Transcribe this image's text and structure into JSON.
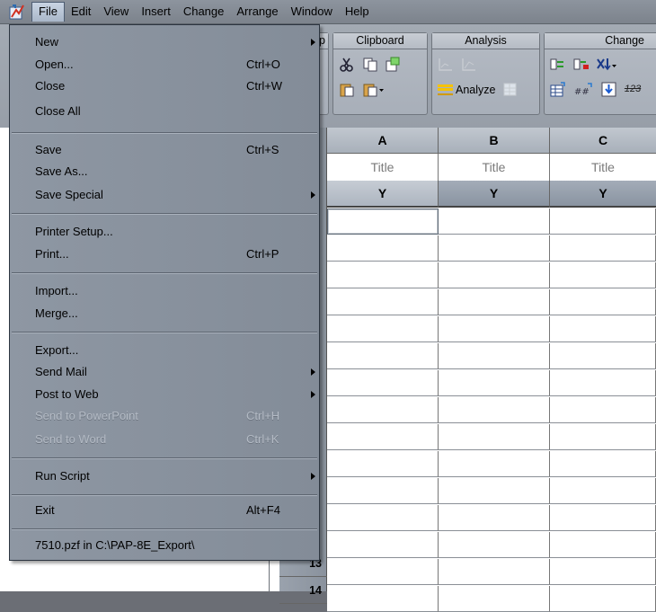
{
  "menubar": {
    "items": [
      "File",
      "Edit",
      "View",
      "Insert",
      "Change",
      "Arrange",
      "Window",
      "Help"
    ],
    "active": "File"
  },
  "toolbar": {
    "partial_group_label": "p",
    "groups": [
      {
        "title": "Clipboard"
      },
      {
        "title": "Analysis",
        "analyze_label": "Analyze"
      },
      {
        "title": "Change",
        "partial_text": "123"
      }
    ]
  },
  "grid": {
    "columns": [
      {
        "letter": "A",
        "title": "Title",
        "subcol": "Y"
      },
      {
        "letter": "B",
        "title": "Title",
        "subcol": "Y"
      },
      {
        "letter": "C",
        "title": "Title",
        "subcol": "Y"
      }
    ],
    "visible_row_numbers": [
      "13",
      "14"
    ]
  },
  "file_menu": {
    "items": [
      {
        "label": "New",
        "submenu": true
      },
      {
        "label": "Open...",
        "shortcut": "Ctrl+O"
      },
      {
        "label": "Close",
        "shortcut": "Ctrl+W"
      },
      {
        "label": "Close All"
      },
      {
        "label": "Save",
        "shortcut": "Ctrl+S"
      },
      {
        "label": "Save As..."
      },
      {
        "label": "Save Special",
        "submenu": true
      },
      {
        "label": "Printer Setup..."
      },
      {
        "label": "Print...",
        "shortcut": "Ctrl+P"
      },
      {
        "label": "Import..."
      },
      {
        "label": "Merge..."
      },
      {
        "label": "Export..."
      },
      {
        "label": "Send Mail",
        "submenu": true
      },
      {
        "label": "Post to Web",
        "submenu": true
      },
      {
        "label": "Send to PowerPoint",
        "shortcut": "Ctrl+H",
        "disabled": true
      },
      {
        "label": "Send to Word",
        "shortcut": "Ctrl+K",
        "disabled": true
      },
      {
        "label": "Run Script",
        "submenu": true
      },
      {
        "label": "Exit",
        "shortcut": "Alt+F4"
      },
      {
        "label": "7510.pzf in C:\\PAP-8E_Export\\"
      }
    ]
  }
}
